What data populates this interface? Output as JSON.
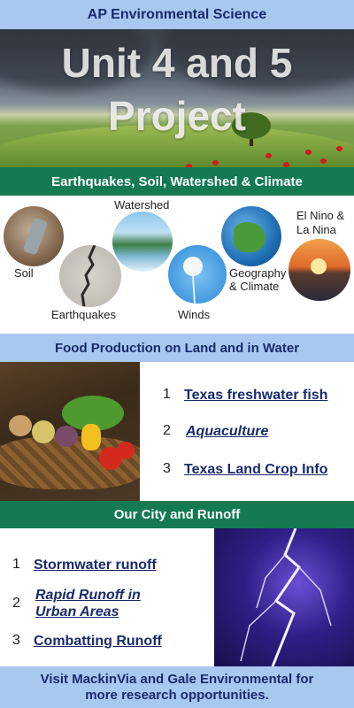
{
  "top_banner": {
    "title": "AP Environmental Science"
  },
  "hero": {
    "title_line1": "Unit 4 and 5",
    "title_line2": "Project"
  },
  "section1": {
    "header": "Earthquakes, Soil, Watershed & Climate",
    "labels": {
      "soil": "Soil",
      "earthquakes": "Earthquakes",
      "watershed": "Watershed",
      "winds": "Winds",
      "geography_line1": "Geography",
      "geography_line2": "& Climate",
      "elnino_line1": "El Nino &",
      "elnino_line2": "La Nina"
    }
  },
  "section2": {
    "header": "Food Production on Land and in Water",
    "items": [
      {
        "number": "1",
        "label": "Texas freshwater fish"
      },
      {
        "number": "2",
        "label": "Aquaculture"
      },
      {
        "number": "3",
        "label": "Texas Land Crop Info"
      }
    ]
  },
  "section3": {
    "header": "Our City and Runoff",
    "items": [
      {
        "number": "1",
        "label": "Stormwater runoff"
      },
      {
        "number": "2",
        "label_line1": "Rapid Runoff in",
        "label_line2": "Urban Areas"
      },
      {
        "number": "3",
        "label": "Combatting Runoff"
      }
    ]
  },
  "bottom_banner": {
    "line1": "Visit MackinVia and Gale Environmental for",
    "line2": "more research opportunities."
  },
  "colors": {
    "light_blue": "#a8c8ef",
    "green": "#137a52",
    "navy": "#1a2a6c"
  }
}
